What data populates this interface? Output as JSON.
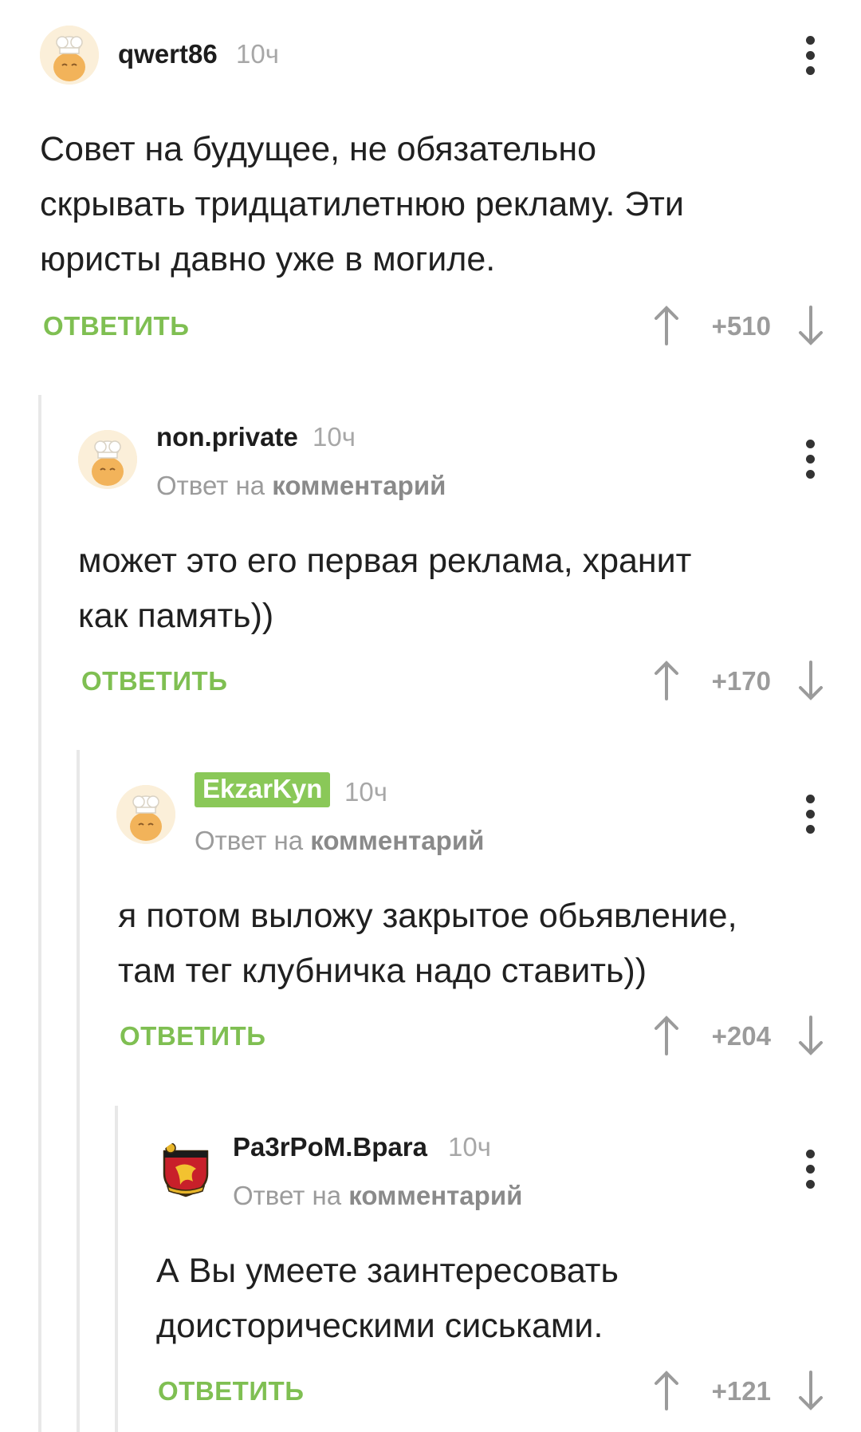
{
  "comments": [
    {
      "author": "qwert86",
      "time": "10ч",
      "reply_prefix": "",
      "reply_target": "",
      "lines": [
        "Совет на будущее, не обязательно",
        "скрывать тридцатилетнюю рекламу. Эти",
        "юристы давно уже в могиле."
      ],
      "reply_label": "ОТВЕТИТЬ",
      "rating": "+510",
      "avatar": "chef-avatar-icon"
    },
    {
      "author": "non.private",
      "time": "10ч",
      "reply_prefix": "Ответ на",
      "reply_target": "комментарий",
      "lines": [
        "может это его первая реклама, хранит",
        "как память))"
      ],
      "reply_label": "ОТВЕТИТЬ",
      "rating": "+170",
      "avatar": "chef-avatar-icon"
    },
    {
      "author": "EkzarKyn",
      "time": "10ч",
      "reply_prefix": "Ответ на",
      "reply_target": "комментарий",
      "lines": [
        "я потом выложу закрытое обьявление,",
        "там тег клубничка надо ставить))"
      ],
      "reply_label": "ОТВЕТИТЬ",
      "rating": "+204",
      "avatar": "chef-avatar-icon",
      "author_color": "#8ac858"
    },
    {
      "author": "Pa3rPoM.Bpara",
      "time": "10ч",
      "reply_prefix": "Ответ на",
      "reply_target": "комментарий",
      "lines": [
        "А Вы умеете заинтересовать",
        "доисторическими сиськами."
      ],
      "reply_label": "ОТВЕТИТЬ",
      "rating": "+121",
      "avatar": "emblem-avatar-icon"
    }
  ],
  "colors": {
    "accent_green": "#7fbf52",
    "highlight_green": "#8ac858",
    "muted_gray": "#9b9b9b"
  }
}
